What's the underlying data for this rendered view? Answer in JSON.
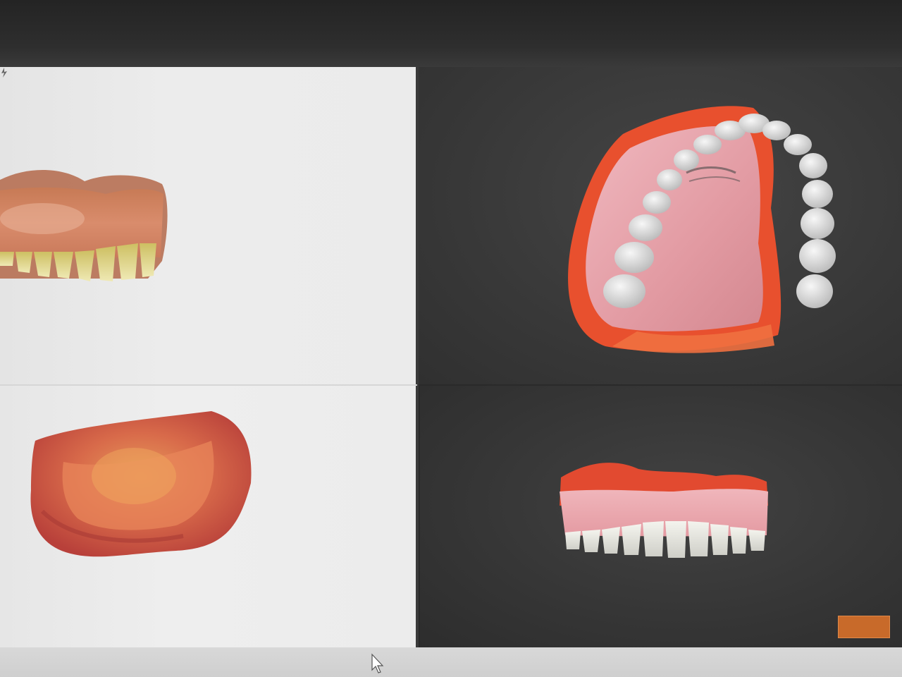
{
  "window": {
    "title": ""
  },
  "views": [
    {
      "id": "original-upper-front",
      "label": ""
    },
    {
      "id": "original-impression",
      "label": ""
    },
    {
      "id": "design-upper-occlusal",
      "label": ""
    },
    {
      "id": "design-upper-front",
      "label": ""
    }
  ],
  "brand": {
    "logo_text": "",
    "logo_sub": ""
  },
  "colors": {
    "light_viewport": "#ebebeb",
    "dark_viewport": "#383838",
    "gingiva_pink": "#e8a6ad",
    "flange_orange": "#e8502e",
    "tooth_white": "#e2e2e2",
    "brand_orange": "#c86a2a"
  }
}
